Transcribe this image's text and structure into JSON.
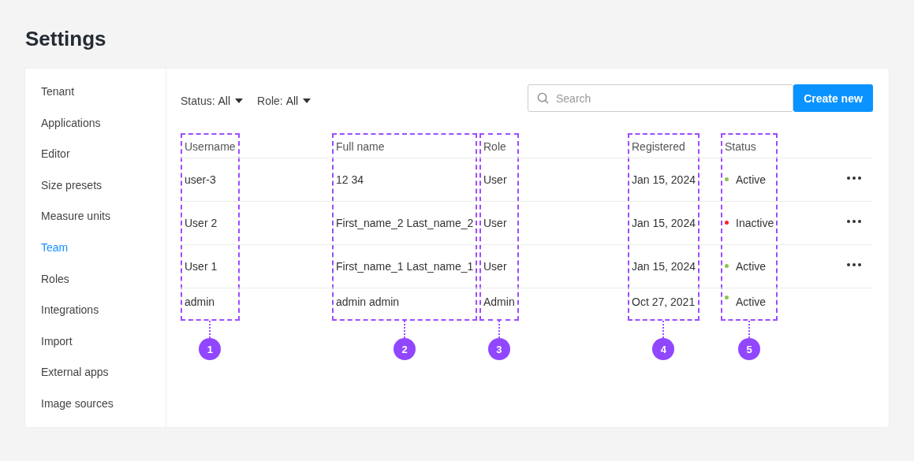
{
  "page_title": "Settings",
  "sidebar": {
    "items": [
      {
        "label": "Tenant",
        "selected": false
      },
      {
        "label": "Applications",
        "selected": false
      },
      {
        "label": "Editor",
        "selected": false
      },
      {
        "label": "Size presets",
        "selected": false
      },
      {
        "label": "Measure units",
        "selected": false
      },
      {
        "label": "Team",
        "selected": true
      },
      {
        "label": "Roles",
        "selected": false
      },
      {
        "label": "Integrations",
        "selected": false
      },
      {
        "label": "Import",
        "selected": false
      },
      {
        "label": "External apps",
        "selected": false
      },
      {
        "label": "Image sources",
        "selected": false
      }
    ]
  },
  "filters": [
    {
      "label": "Status:",
      "value": "All"
    },
    {
      "label": "Role:",
      "value": "All"
    }
  ],
  "search": {
    "placeholder": "Search"
  },
  "create_button": "Create new",
  "table": {
    "columns": [
      {
        "label": "Username",
        "callout": "1"
      },
      {
        "label": "Full name",
        "callout": "2"
      },
      {
        "label": "Role",
        "callout": "3"
      },
      {
        "label": "Registered",
        "callout": "4"
      },
      {
        "label": "Status",
        "callout": "5"
      }
    ],
    "rows": [
      {
        "username": "user-3",
        "full_name": "12 34",
        "role": "User",
        "registered": "Jan 15, 2024",
        "status": "Active",
        "color": "#8bc34a",
        "has_menu": true
      },
      {
        "username": "User 2",
        "full_name": "First_name_2 Last_name_2",
        "role": "User",
        "registered": "Jan 15, 2024",
        "status": "Inactive",
        "color": "#f5222d",
        "has_menu": true
      },
      {
        "username": "User 1",
        "full_name": "First_name_1 Last_name_1",
        "role": "User",
        "registered": "Jan 15, 2024",
        "status": "Active",
        "color": "#8bc34a",
        "has_menu": true
      },
      {
        "username": "admin",
        "full_name": "admin admin",
        "role": "Admin",
        "registered": "Oct 27, 2021",
        "status": "Active",
        "color": "#8bc34a",
        "has_menu": false
      }
    ]
  }
}
